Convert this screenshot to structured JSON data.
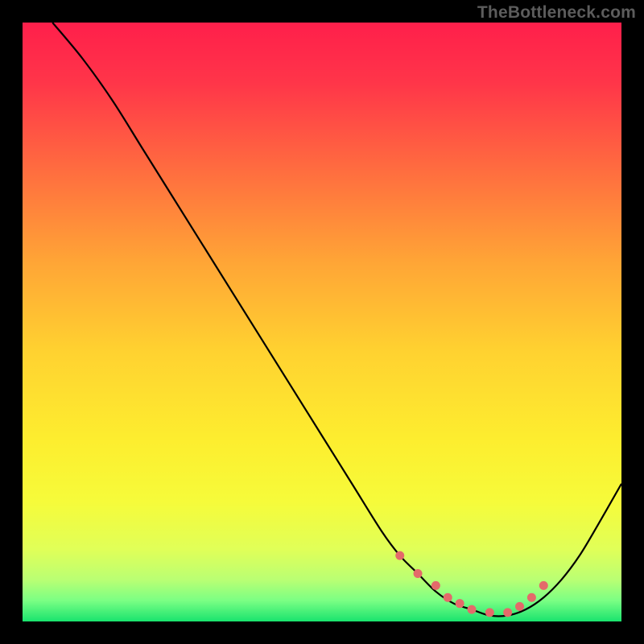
{
  "watermark": "TheBottleneck.com",
  "chart_data": {
    "type": "line",
    "title": "",
    "xlabel": "",
    "ylabel": "",
    "xlim": [
      0,
      100
    ],
    "ylim": [
      0,
      100
    ],
    "grid": false,
    "series": [
      {
        "name": "bottleneck-curve",
        "x": [
          5,
          10,
          15,
          20,
          25,
          30,
          35,
          40,
          45,
          50,
          55,
          60,
          63,
          66,
          69,
          72,
          75,
          78,
          81,
          84,
          87,
          90,
          93,
          96,
          100
        ],
        "y": [
          100,
          94,
          87,
          79,
          71,
          63,
          55,
          47,
          39,
          31,
          23,
          15,
          11,
          8,
          5,
          3,
          2,
          1,
          1,
          2,
          4,
          7,
          11,
          16,
          23
        ]
      },
      {
        "name": "optimal-markers",
        "x": [
          63,
          66,
          69,
          71,
          73,
          75,
          78,
          81,
          83,
          85,
          87
        ],
        "y": [
          11,
          8,
          6,
          4,
          3,
          2,
          1.5,
          1.5,
          2.5,
          4,
          6
        ]
      }
    ],
    "gradient_stops": [
      {
        "offset": 0.0,
        "color": "#ff1f4b"
      },
      {
        "offset": 0.1,
        "color": "#ff3549"
      },
      {
        "offset": 0.25,
        "color": "#ff6e3f"
      },
      {
        "offset": 0.4,
        "color": "#ffa536"
      },
      {
        "offset": 0.55,
        "color": "#ffd230"
      },
      {
        "offset": 0.7,
        "color": "#fdee2f"
      },
      {
        "offset": 0.8,
        "color": "#f6fb3a"
      },
      {
        "offset": 0.88,
        "color": "#e0ff58"
      },
      {
        "offset": 0.93,
        "color": "#baff73"
      },
      {
        "offset": 0.965,
        "color": "#7bff84"
      },
      {
        "offset": 1.0,
        "color": "#19e36e"
      }
    ],
    "marker_color": "#e46a6a",
    "curve_color": "#000000"
  }
}
